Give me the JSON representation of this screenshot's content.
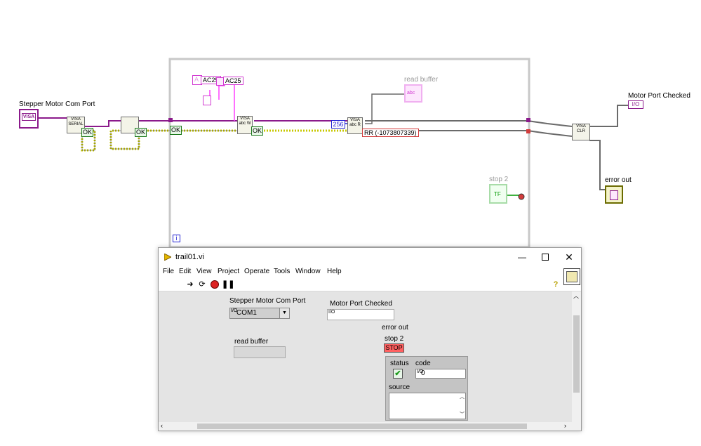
{
  "block_diagram": {
    "port_label": "Stepper Motor Com Port",
    "visa_terminal": "VISA",
    "visa_serial_node": "VISA SERIAL",
    "ok_labels": [
      "OK",
      "OK",
      "OK",
      "OK"
    ],
    "string_constants": [
      "AC25",
      "AC25"
    ],
    "string_const_prefix": "A",
    "read_buffer_label": "read buffer",
    "read_buffer_terminal": "abc",
    "byte_count": "256",
    "error_cluster": "RR (-1073807339)",
    "visa_write_node": "VISA abc W",
    "visa_read_node": "VISA abc R",
    "stop_label": "stop 2",
    "stop_terminal": "TF",
    "motor_port_checked_label": "Motor Port Checked",
    "motor_port_checked_terminal": "I/O",
    "visa_close_node": "VISA CLR",
    "error_out_label": "error out",
    "loop_iteration": "i",
    "colors": {
      "visa_wire": "#8b1a8b",
      "error_wire": "#6b6b00",
      "string_wire": "#ff40ff",
      "loop_border": "#c8c8c8",
      "bool_wire": "#009900"
    }
  },
  "window": {
    "title": "trail01.vi",
    "menu": [
      "File",
      "Edit",
      "View",
      "Project",
      "Operate",
      "Tools",
      "Window",
      "Help"
    ],
    "toolbar_icons": [
      "run-arrow-icon",
      "run-continuous-icon",
      "abort-icon",
      "pause-icon"
    ],
    "help_icon": "?",
    "controls": {
      "com_port_label": "Stepper Motor Com Port",
      "com_port_value": "COM1",
      "motor_port_checked_label": "Motor Port Checked",
      "motor_port_checked_value": "",
      "read_buffer_label": "read buffer",
      "read_buffer_value": "",
      "error_out_label": "error out",
      "stop_label": "stop 2",
      "stop_button": "STOP",
      "status_label": "status",
      "code_label": "code",
      "code_value": "0",
      "source_label": "source",
      "source_value": ""
    },
    "io_prefix": "I/O"
  }
}
